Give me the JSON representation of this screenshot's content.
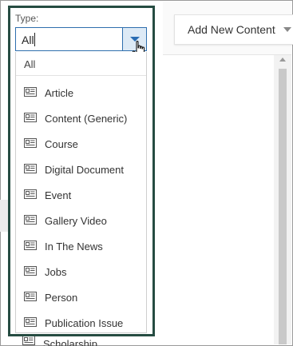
{
  "filter": {
    "label": "Type:",
    "selected_value": "All"
  },
  "toolbar": {
    "add_new_content_label": "Add New Content"
  },
  "dropdown": {
    "all_option": "All",
    "options": [
      {
        "label": "Article",
        "icon": "content-card-icon"
      },
      {
        "label": "Content (Generic)",
        "icon": "content-card-icon"
      },
      {
        "label": "Course",
        "icon": "content-card-icon"
      },
      {
        "label": "Digital Document",
        "icon": "content-card-icon"
      },
      {
        "label": "Event",
        "icon": "content-card-icon"
      },
      {
        "label": "Gallery Video",
        "icon": "content-card-icon"
      },
      {
        "label": "In The News",
        "icon": "content-card-icon"
      },
      {
        "label": "Jobs",
        "icon": "content-card-icon"
      },
      {
        "label": "Person",
        "icon": "content-card-icon"
      },
      {
        "label": "Publication Issue",
        "icon": "content-card-icon"
      }
    ],
    "partially_visible_option": "Scholarship"
  },
  "colors": {
    "highlight_border": "#264c42",
    "select_border": "#2f6fae",
    "toggle_bg": "#ddeaf6",
    "arrow": "#2a6cb3"
  }
}
